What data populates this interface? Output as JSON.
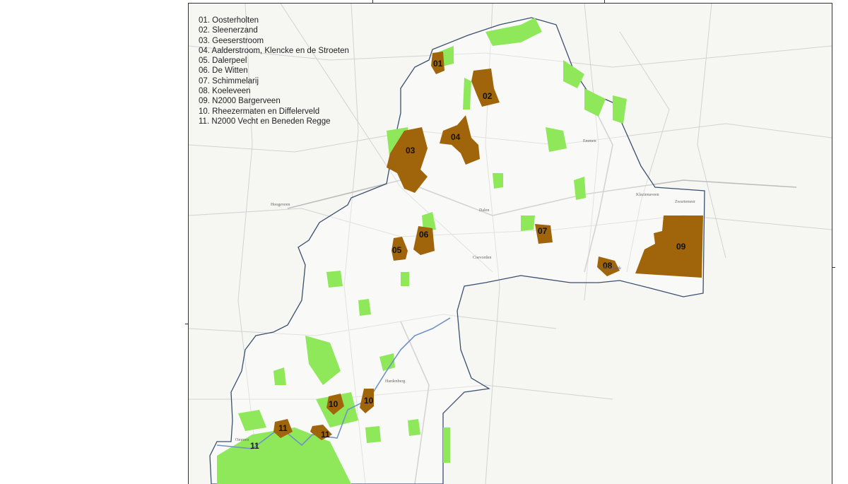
{
  "legend": [
    "01. Oosterholten",
    "02. Sleenerzand",
    "03. Geeserstroom",
    "04. Aalderstroom, Klencke en de Stroeten",
    "05. Dalerpeel",
    "06. De Witten",
    "07. Schimmelarij",
    "08. Koeleveen",
    "09. N2000 Bargerveen",
    "10. Rheezermaten en Diffelerveld",
    "11. N2000 Vecht en Beneden Regge"
  ],
  "area_labels": [
    "01",
    "02",
    "03",
    "04",
    "05",
    "06",
    "07",
    "08",
    "09",
    "10",
    "10",
    "11",
    "11",
    "11"
  ],
  "place_names": [
    "Emmen",
    "Klazienaveen",
    "Zwartemeer",
    "Coevorden",
    "Hoogeveen",
    "Hardenberg",
    "Ommen",
    "Schoonebeek",
    "Dalen"
  ],
  "colors": {
    "natura_area": "#a0640a",
    "green_area": "#8ee85a",
    "boundary": "#3b4f6e",
    "river": "#6f93c4",
    "road": "#cfcfcf",
    "background": "#f6f6f3"
  }
}
